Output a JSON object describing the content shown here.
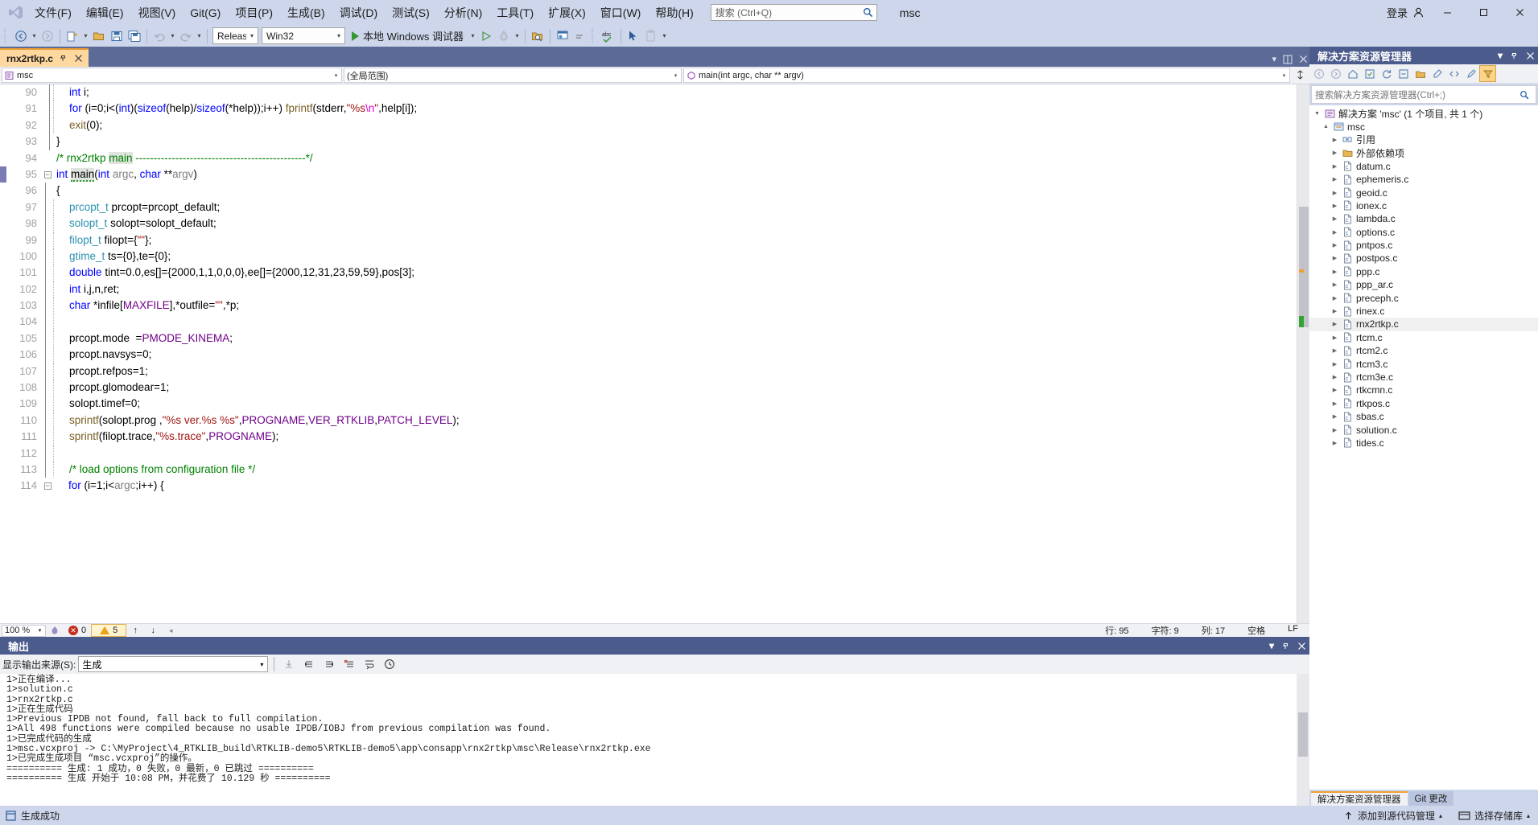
{
  "window": {
    "project_name": "msc",
    "signin_label": "登录",
    "minimize": "—",
    "maximize": "▢",
    "close": "✕"
  },
  "menu": {
    "items": [
      {
        "label": "文件(F)",
        "name": "menu-file"
      },
      {
        "label": "编辑(E)",
        "name": "menu-edit"
      },
      {
        "label": "视图(V)",
        "name": "menu-view"
      },
      {
        "label": "Git(G)",
        "name": "menu-git"
      },
      {
        "label": "项目(P)",
        "name": "menu-project"
      },
      {
        "label": "生成(B)",
        "name": "menu-build"
      },
      {
        "label": "调试(D)",
        "name": "menu-debug"
      },
      {
        "label": "测试(S)",
        "name": "menu-test"
      },
      {
        "label": "分析(N)",
        "name": "menu-analyze"
      },
      {
        "label": "工具(T)",
        "name": "menu-tools"
      },
      {
        "label": "扩展(X)",
        "name": "menu-extensions"
      },
      {
        "label": "窗口(W)",
        "name": "menu-window"
      },
      {
        "label": "帮助(H)",
        "name": "menu-help"
      }
    ],
    "search_placeholder": "搜索 (Ctrl+Q)"
  },
  "toolbar": {
    "config": "Release",
    "platform": "Win32",
    "run_label": "本地 Windows 调试器",
    "live_share": "Live Share"
  },
  "editor": {
    "tab_name": "rnx2rtkp.c",
    "nav_project": "msc",
    "nav_scope": "(全局范围)",
    "nav_member": "main(int argc, char ** argv)",
    "zoom": "100 %",
    "errors": "0",
    "warnings": "5",
    "status_row_label": "行: 95",
    "status_col_label": "字符: 9",
    "status_char_label": "列: 17",
    "status_insert": "空格",
    "status_eol": "LF",
    "first_line": 90,
    "lines": [
      {
        "n": 90,
        "text": "    int i;"
      },
      {
        "n": 91,
        "text": "    for (i=0;i<(int)(sizeof(help)/sizeof(*help));i++) fprintf(stderr,\"%s\\n\",help[i]);"
      },
      {
        "n": 92,
        "text": "    exit(0);"
      },
      {
        "n": 93,
        "text": "}"
      },
      {
        "n": 94,
        "text": "/* rnx2rtkp main -----------------------------------------------*/"
      },
      {
        "n": 95,
        "text": "int main(int argc, char **argv)"
      },
      {
        "n": 96,
        "text": "{"
      },
      {
        "n": 97,
        "text": "    prcopt_t prcopt=prcopt_default;"
      },
      {
        "n": 98,
        "text": "    solopt_t solopt=solopt_default;"
      },
      {
        "n": 99,
        "text": "    filopt_t filopt={\"\"};"
      },
      {
        "n": 100,
        "text": "    gtime_t ts={0},te={0};"
      },
      {
        "n": 101,
        "text": "    double tint=0.0,es[]={2000,1,1,0,0,0},ee[]={2000,12,31,23,59,59},pos[3];"
      },
      {
        "n": 102,
        "text": "    int i,j,n,ret;"
      },
      {
        "n": 103,
        "text": "    char *infile[MAXFILE],*outfile=\"\",*p;"
      },
      {
        "n": 104,
        "text": ""
      },
      {
        "n": 105,
        "text": "    prcopt.mode  =PMODE_KINEMA;"
      },
      {
        "n": 106,
        "text": "    prcopt.navsys=0;"
      },
      {
        "n": 107,
        "text": "    prcopt.refpos=1;"
      },
      {
        "n": 108,
        "text": "    prcopt.glomodear=1;"
      },
      {
        "n": 109,
        "text": "    solopt.timef=0;"
      },
      {
        "n": 110,
        "text": "    sprintf(solopt.prog ,\"%s ver.%s %s\",PROGNAME,VER_RTKLIB,PATCH_LEVEL);"
      },
      {
        "n": 111,
        "text": "    sprintf(filopt.trace,\"%s.trace\",PROGNAME);"
      },
      {
        "n": 112,
        "text": ""
      },
      {
        "n": 113,
        "text": "    /* load options from configuration file */"
      },
      {
        "n": 114,
        "text": "    for (i=1;i<argc;i++) {"
      }
    ]
  },
  "output": {
    "title": "输出",
    "source_label": "显示输出来源(S):",
    "source_value": "生成",
    "lines": [
      "1>正在编译...",
      "1>solution.c",
      "1>rnx2rtkp.c",
      "1>正在生成代码",
      "1>Previous IPDB not found, fall back to full compilation.",
      "1>All 498 functions were compiled because no usable IPDB/IOBJ from previous compilation was found.",
      "1>已完成代码的生成",
      "1>msc.vcxproj -> C:\\MyProject\\4_RTKLIB_build\\RTKLIB-demo5\\RTKLIB-demo5\\app\\consapp\\rnx2rtkp\\msc\\Release\\rnx2rtkp.exe",
      "1>已完成生成项目 “msc.vcxproj”的操作。",
      "========== 生成: 1 成功，0 失败，0 最新，0 已跳过 ==========",
      "========== 生成 开始于 10:08 PM，并花费了 10.129 秒 =========="
    ]
  },
  "solution_explorer": {
    "title": "解决方案资源管理器",
    "search_placeholder": "搜索解决方案资源管理器(Ctrl+;)",
    "root": "解决方案 'msc' (1 个项目, 共 1 个)",
    "project": "msc",
    "tree": [
      {
        "label": "引用",
        "depth": 2,
        "icon": "references-icon",
        "expander": "▶"
      },
      {
        "label": "外部依赖项",
        "depth": 2,
        "icon": "folder-icon",
        "expander": "▶"
      },
      {
        "label": "datum.c",
        "depth": 2,
        "icon": "c-file-icon",
        "expander": "▶"
      },
      {
        "label": "ephemeris.c",
        "depth": 2,
        "icon": "c-file-icon",
        "expander": "▶"
      },
      {
        "label": "geoid.c",
        "depth": 2,
        "icon": "c-file-icon",
        "expander": "▶"
      },
      {
        "label": "ionex.c",
        "depth": 2,
        "icon": "c-file-icon",
        "expander": "▶"
      },
      {
        "label": "lambda.c",
        "depth": 2,
        "icon": "c-file-icon",
        "expander": "▶"
      },
      {
        "label": "options.c",
        "depth": 2,
        "icon": "c-file-icon",
        "expander": "▶"
      },
      {
        "label": "pntpos.c",
        "depth": 2,
        "icon": "c-file-icon",
        "expander": "▶"
      },
      {
        "label": "postpos.c",
        "depth": 2,
        "icon": "c-file-icon",
        "expander": "▶"
      },
      {
        "label": "ppp.c",
        "depth": 2,
        "icon": "c-file-icon",
        "expander": "▶"
      },
      {
        "label": "ppp_ar.c",
        "depth": 2,
        "icon": "c-file-icon",
        "expander": "▶"
      },
      {
        "label": "preceph.c",
        "depth": 2,
        "icon": "c-file-icon",
        "expander": "▶"
      },
      {
        "label": "rinex.c",
        "depth": 2,
        "icon": "c-file-icon",
        "expander": "▶"
      },
      {
        "label": "rnx2rtkp.c",
        "depth": 2,
        "icon": "c-file-icon",
        "expander": "▶",
        "selected": true
      },
      {
        "label": "rtcm.c",
        "depth": 2,
        "icon": "c-file-icon",
        "expander": "▶"
      },
      {
        "label": "rtcm2.c",
        "depth": 2,
        "icon": "c-file-icon",
        "expander": "▶"
      },
      {
        "label": "rtcm3.c",
        "depth": 2,
        "icon": "c-file-icon",
        "expander": "▶"
      },
      {
        "label": "rtcm3e.c",
        "depth": 2,
        "icon": "c-file-icon",
        "expander": "▶"
      },
      {
        "label": "rtkcmn.c",
        "depth": 2,
        "icon": "c-file-icon",
        "expander": "▶"
      },
      {
        "label": "rtkpos.c",
        "depth": 2,
        "icon": "c-file-icon",
        "expander": "▶"
      },
      {
        "label": "sbas.c",
        "depth": 2,
        "icon": "c-file-icon",
        "expander": "▶"
      },
      {
        "label": "solution.c",
        "depth": 2,
        "icon": "c-file-icon",
        "expander": "▶"
      },
      {
        "label": "tides.c",
        "depth": 2,
        "icon": "c-file-icon",
        "expander": "▶"
      }
    ],
    "tabs": [
      {
        "label": "解决方案资源管理器",
        "active": true
      },
      {
        "label": "Git 更改",
        "active": false
      }
    ]
  },
  "statusbar": {
    "build_result": "生成成功",
    "source_control": "添加到源代码管理",
    "repo": "选择存储库"
  },
  "colors": {
    "chrome": "#cdd6ea",
    "panel_header": "#4a5b8c",
    "accent_orange": "#f0a030",
    "tab_active": "#ffd8a0"
  }
}
